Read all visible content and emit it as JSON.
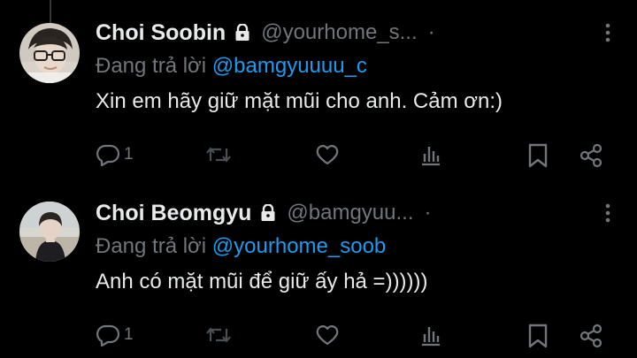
{
  "tweets": [
    {
      "display_name": "Choi Soobin",
      "handle": "@yourhome_s...",
      "separator": "·",
      "reply_prefix": "Đang trả lời",
      "reply_to": "@bamgyuuuu_c",
      "text": "Xin em hãy giữ mặt mũi cho anh. Cảm ơn:)",
      "reply_count": "1",
      "icons": [
        "lock-icon",
        "more-icon",
        "reply-icon",
        "retweet-icon",
        "like-icon",
        "views-icon",
        "bookmark-icon",
        "share-icon"
      ]
    },
    {
      "display_name": "Choi Beomgyu",
      "handle": "@bamgyuu...",
      "separator": "·",
      "reply_prefix": "Đang trả lời",
      "reply_to": "@yourhome_soob",
      "text": "Anh có mặt mũi để giữ ấy hả =))))))",
      "reply_count": "1",
      "icons": [
        "lock-icon",
        "more-icon",
        "reply-icon",
        "retweet-icon",
        "like-icon",
        "views-icon",
        "bookmark-icon",
        "share-icon"
      ]
    }
  ],
  "colors": {
    "background": "#000000",
    "primary_text": "#e7e9ea",
    "secondary_text": "#71767b",
    "mention": "#1d9bf0",
    "thread_line": "#333639"
  }
}
